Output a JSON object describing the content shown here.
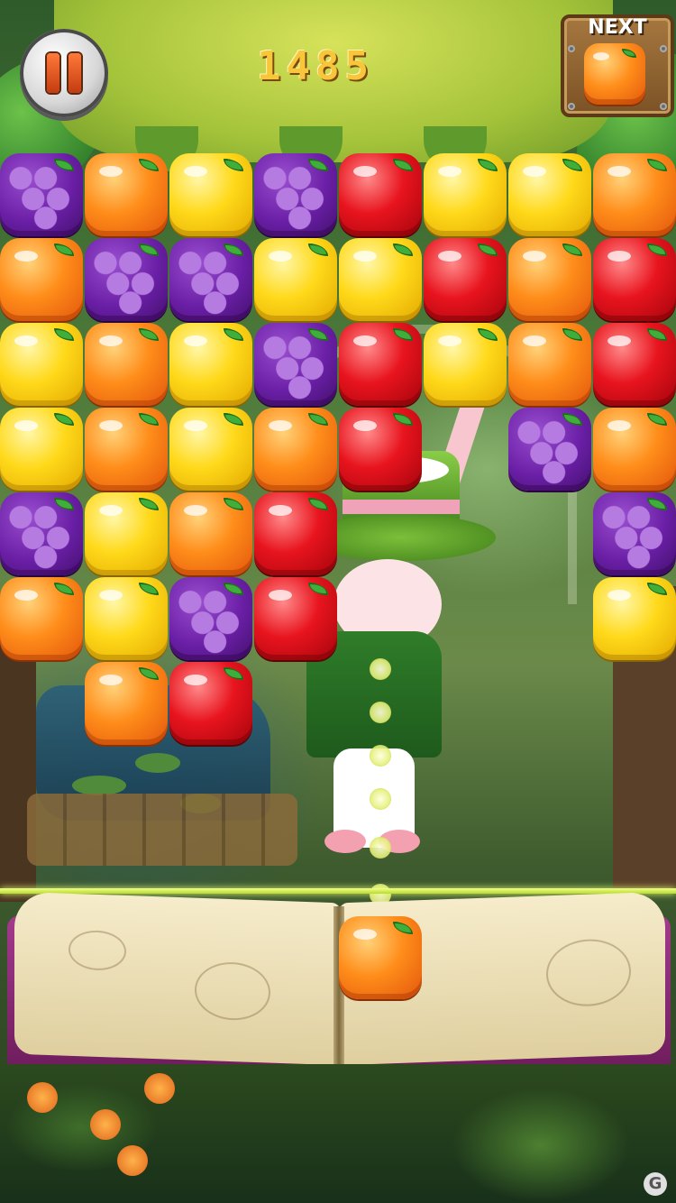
{
  "hud": {
    "score": "1485",
    "next_label": "NEXT",
    "next_fruit": "orange",
    "pause_icon": "pause-icon"
  },
  "board": {
    "columns": 8,
    "rows": [
      [
        "grape",
        "orange",
        "lemon",
        "grape",
        "apple",
        "lemon",
        "lemon",
        "orange"
      ],
      [
        "orange",
        "grape",
        "grape",
        "lemon",
        "lemon",
        "apple",
        "orange",
        "apple"
      ],
      [
        "lemon",
        "orange",
        "lemon",
        "grape",
        "apple",
        "lemon",
        "orange",
        "apple"
      ],
      [
        "lemon",
        "orange",
        "lemon",
        "orange",
        "apple",
        "",
        "grape",
        "orange"
      ],
      [
        "grape",
        "lemon",
        "orange",
        "apple",
        "",
        "",
        "",
        "grape"
      ],
      [
        "orange",
        "lemon",
        "grape",
        "apple",
        "",
        "",
        "",
        "lemon"
      ],
      [
        "",
        "orange",
        "apple",
        "",
        "",
        "",
        "",
        ""
      ]
    ]
  },
  "active_piece": "orange",
  "fruit_colors": {
    "orange": "#ff8d1a",
    "lemon": "#ffd91a",
    "apple": "#e8141e",
    "grape": "#6a1fa6"
  },
  "watermark": "G"
}
